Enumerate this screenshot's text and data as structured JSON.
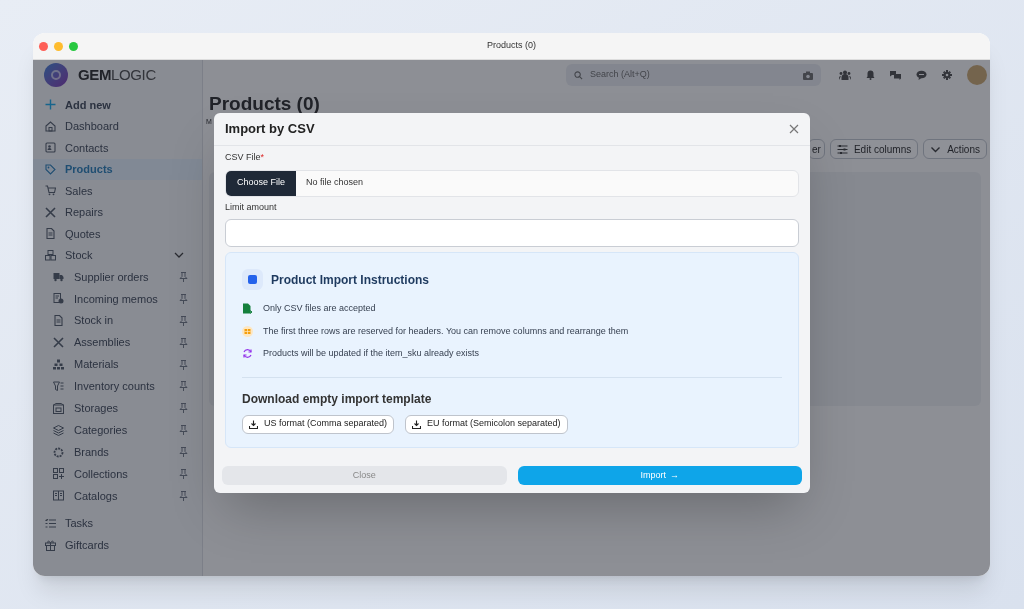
{
  "window": {
    "title": "Products (0)"
  },
  "app": {
    "logo": {
      "bold": "GEM",
      "light": "LOGIC"
    },
    "search": {
      "placeholder": "Search (Alt+Q)"
    },
    "sidebar": {
      "items": [
        {
          "kind": "action",
          "label": "Add new",
          "selected": false
        },
        {
          "kind": "link",
          "label": "Dashboard",
          "selected": false
        },
        {
          "kind": "link",
          "label": "Contacts",
          "selected": false
        },
        {
          "kind": "link",
          "label": "Products",
          "selected": true
        },
        {
          "kind": "link",
          "label": "Sales",
          "selected": false
        },
        {
          "kind": "link",
          "label": "Repairs",
          "selected": false
        },
        {
          "kind": "link",
          "label": "Quotes",
          "selected": false
        },
        {
          "kind": "group",
          "label": "Stock",
          "selected": false,
          "expanded": true,
          "children": [
            {
              "label": "Supplier orders",
              "selected": false
            },
            {
              "label": "Incoming memos",
              "selected": false
            },
            {
              "label": "Stock in",
              "selected": false
            },
            {
              "label": "Assemblies",
              "selected": false
            },
            {
              "label": "Materials",
              "selected": false
            },
            {
              "label": "Inventory counts",
              "selected": false
            },
            {
              "label": "Storages",
              "selected": false
            },
            {
              "label": "Categories",
              "selected": false
            },
            {
              "label": "Brands",
              "selected": false
            },
            {
              "label": "Collections",
              "selected": false
            },
            {
              "label": "Catalogs",
              "selected": false
            }
          ]
        },
        {
          "kind": "link",
          "label": "Tasks",
          "selected": false
        },
        {
          "kind": "link",
          "label": "Giftcards",
          "selected": false
        }
      ]
    },
    "page": {
      "title": "Products (0)",
      "subtitle": "M",
      "toolbar": [
        "er",
        "Edit columns",
        "Actions"
      ]
    }
  },
  "modal": {
    "title": "Import by CSV",
    "fields": [
      {
        "kind": "file",
        "label": "CSV File",
        "required_mark": "*",
        "button": "Choose File",
        "value": "No file chosen"
      },
      {
        "kind": "text",
        "label": "Limit amount"
      }
    ],
    "instructions": {
      "title": "Product Import Instructions",
      "items": [
        "Only CSV files are accepted",
        "The first three rows are reserved for headers. You can remove columns and rearrange them",
        "Products will be updated if the item_sku already exists"
      ],
      "template_title": "Download empty import template",
      "downloads": [
        "US format (Comma separated)",
        "EU format (Semicolon separated)"
      ]
    },
    "buttons": [
      {
        "kind": "secondary",
        "label": "Close"
      },
      {
        "kind": "primary",
        "label": "Import",
        "arrow": "→"
      }
    ]
  }
}
